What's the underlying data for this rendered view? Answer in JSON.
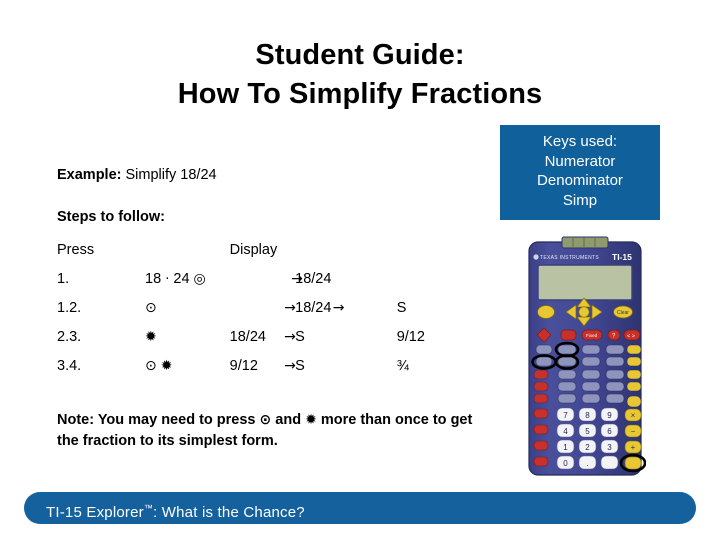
{
  "title": {
    "line1": "Student Guide:",
    "line2": "How To Simplify Fractions"
  },
  "keys_box": {
    "heading": "Keys used:",
    "key1": "Numerator",
    "key2": "Denominator",
    "key3": "Simp",
    "bg_color": "#10609b",
    "text_color": "#ffffff"
  },
  "example": {
    "label": "Example:",
    "text": "Simplify 18/24"
  },
  "steps_heading": "Steps to follow:",
  "table": {
    "headers": {
      "press": "Press",
      "display": "Display"
    },
    "rows": [
      {
        "num": "1.",
        "press": "18",
        "press_sep": "·",
        "press2": "24",
        "press_key": "◎",
        "mid": "",
        "display": "18/24",
        "display_arrow_over": "→",
        "last": ""
      },
      {
        "num": "1.2.",
        "press": "",
        "press_sep": "",
        "press2": "",
        "press_key": "⊙",
        "mid": "",
        "display": "18/24",
        "display_arrow_left": "→",
        "display_arrow_right": "→",
        "last": "S"
      },
      {
        "num": "2.3.",
        "press": "",
        "press_sep": "",
        "press2": "",
        "press_key": "✹",
        "mid": "18/24",
        "display": "S",
        "display_arrow_left": "→",
        "last": "9/12"
      },
      {
        "num": "3.4.",
        "press": "",
        "press_sep": "",
        "press2": "",
        "press_key": "⊙",
        "press_key2": "✹",
        "mid": "9/12",
        "display": "S",
        "display_arrow_left": "→",
        "last": "¾"
      }
    ]
  },
  "note": {
    "line1_a": "Note: You may need to press ",
    "key_a": "⊙",
    "line1_b": " and ",
    "key_b": "✹",
    "line1_c": " more than",
    "line2": "once to get the fraction to its simplest form."
  },
  "footer": {
    "product": "TI-15 Explorer",
    "trademark": "™",
    "subtitle": ": What is the Chance?",
    "bg_color": "#15619e"
  },
  "calculator": {
    "brand": "TEXAS INSTRUMENTS",
    "model": "TI-15",
    "highlighted_keys": [
      "numerator-key",
      "simp-key",
      "denominator-key",
      "enter-key"
    ]
  }
}
